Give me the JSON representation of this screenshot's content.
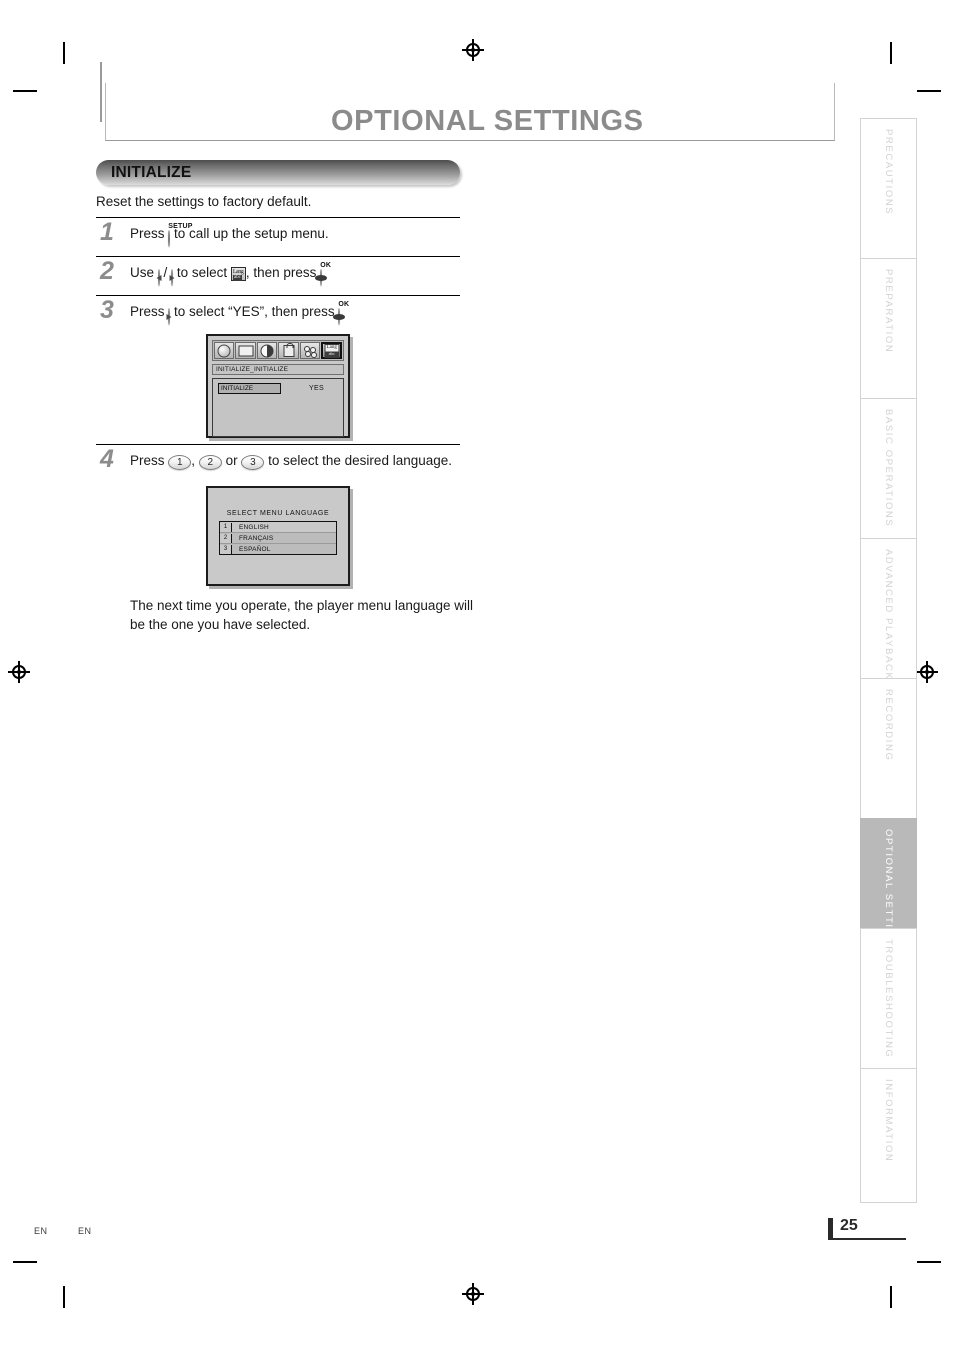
{
  "header": {
    "title": "OPTIONAL SETTINGS"
  },
  "section": {
    "bar_label": "INITIALIZE",
    "intro": "Reset the settings to factory default."
  },
  "steps": [
    {
      "number": "1",
      "text_before": "Press",
      "key_caption": "SETUP",
      "text_after": "to call up the setup menu."
    },
    {
      "number": "2",
      "text_a": "Use",
      "sep": "/",
      "text_b": "to select",
      "text_c": ", then press",
      "ok_caption": "OK",
      "text_d": "."
    },
    {
      "number": "3",
      "text_a": "Press",
      "text_b": "to select “YES”, then press",
      "ok_caption": "OK",
      "text_c": "."
    },
    {
      "number": "4",
      "text_a": "Press",
      "n1": "1",
      "comma": ",",
      "n2": "2",
      "or": "or",
      "n3": "3",
      "text_b": "to select the desired language."
    }
  ],
  "osd_initialize": {
    "icons": [
      {
        "name": "disc-icon",
        "selected": false
      },
      {
        "name": "display-icon",
        "selected": false
      },
      {
        "name": "contrast-icon",
        "selected": false
      },
      {
        "name": "lock-icon",
        "selected": false
      },
      {
        "name": "custom-icon",
        "selected": false
      },
      {
        "name": "language-icon",
        "selected": true
      }
    ],
    "breadcrumb": "INITIALIZE_INITIALIZE",
    "item_label": "INITIALIZE",
    "item_value": "YES"
  },
  "osd_language": {
    "title": "SELECT MENU LANGUAGE",
    "rows": [
      {
        "no": "1",
        "name": "ENGLISH"
      },
      {
        "no": "2",
        "name": "FRANÇAIS"
      },
      {
        "no": "3",
        "name": "ESPAÑOL"
      }
    ]
  },
  "outro": "The next time you operate, the player menu language will be the one you have selected.",
  "tabs": [
    {
      "label": "PRECAUTIONS",
      "active": false
    },
    {
      "label": "PREPARATION",
      "active": false
    },
    {
      "label": "BASIC  OPERATIONS",
      "active": false
    },
    {
      "label": "ADVANCED  PLAYBACK",
      "active": false
    },
    {
      "label": "RECORDING",
      "active": false
    },
    {
      "label": "OPTIONAL  SETTINGS",
      "active": true
    },
    {
      "label": "TROUBLESHOOTING",
      "active": false
    },
    {
      "label": "INFORMATION",
      "active": false
    }
  ],
  "footer": {
    "lang_left": "EN",
    "lang_right": "EN",
    "page_number": "25"
  },
  "colors": {
    "title_gray": "#8b8b8b",
    "tab_text": "#d2d2d2",
    "tab_active_bg": "#b9b9b9",
    "osd_bg": "#c9c9c9"
  }
}
